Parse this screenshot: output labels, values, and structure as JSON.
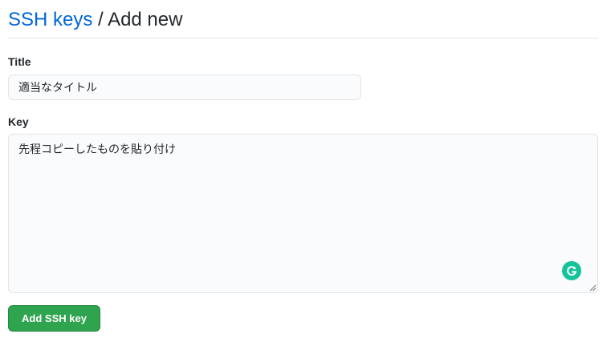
{
  "breadcrumb": {
    "parent": "SSH keys",
    "separator": "/",
    "current": "Add new"
  },
  "form": {
    "title_label": "Title",
    "title_value": "適当なタイトル",
    "key_label": "Key",
    "key_value": "先程コピーしたものを貼り付け",
    "submit_label": "Add SSH key"
  },
  "colors": {
    "link": "#0366d6",
    "primary_button": "#2ea44f",
    "grammarly": "#15c39a"
  },
  "icons": {
    "grammarly": "grammarly-icon",
    "resize": "resize-grip-icon"
  }
}
